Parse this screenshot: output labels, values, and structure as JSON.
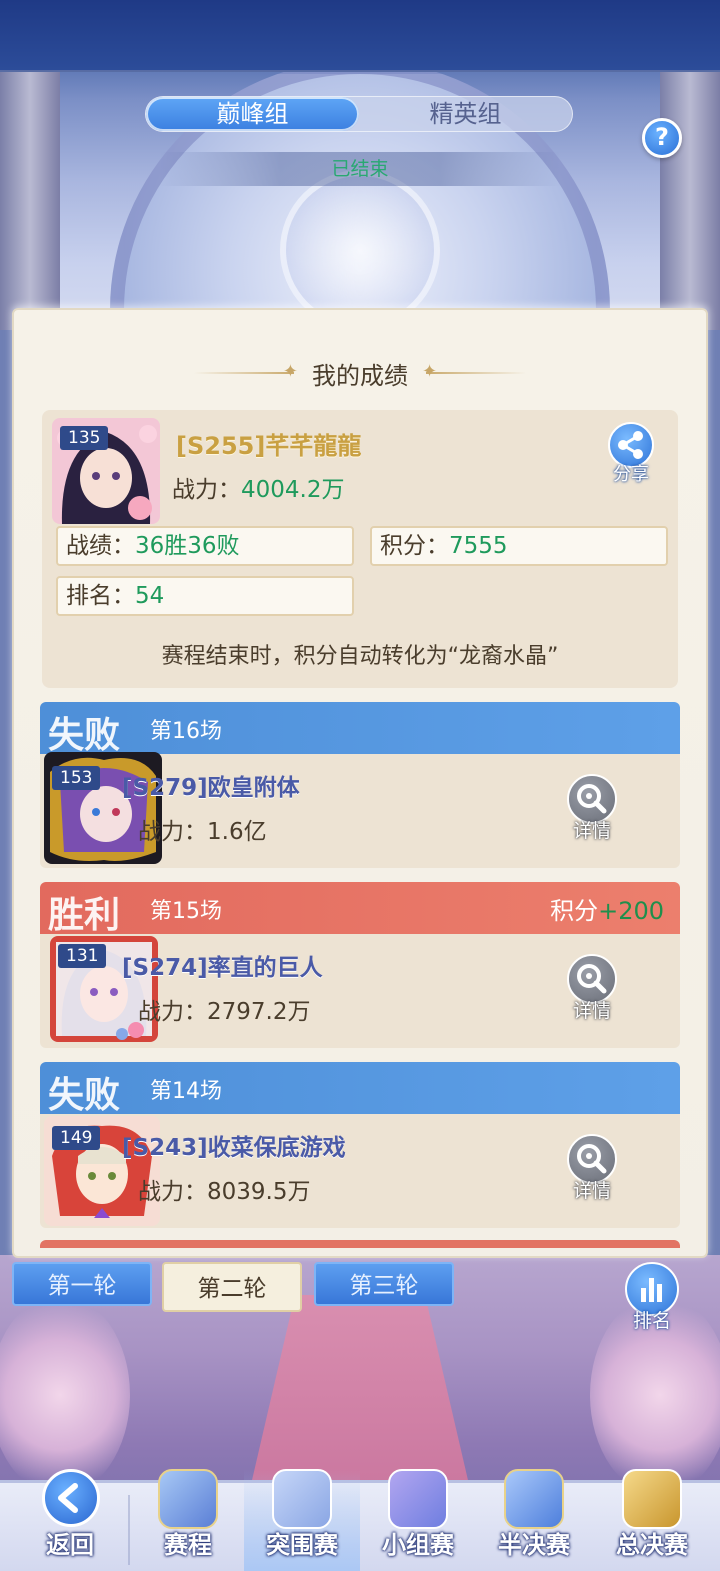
{
  "groups": {
    "peak": "巅峰组",
    "elite": "精英组",
    "active": "peak"
  },
  "status": "已结束",
  "help_label": "?",
  "panel_title": "我的成绩",
  "me": {
    "level": "135",
    "name": "[S255]芊芊龍龍",
    "power_label": "战力：",
    "power_value": "4004.2万",
    "share_label": "分享",
    "record_label": "战绩：",
    "record_value": "36胜36败",
    "score_label": "积分：",
    "score_value": "7555",
    "rank_label": "排名：",
    "rank_value": "54"
  },
  "convert_note": "赛程结束时，积分自动转化为“龙裔水晶”",
  "matches": [
    {
      "result": "失败",
      "round": "第16场",
      "level": "153",
      "opponent": "[S279]欧皇附体",
      "power_label": "战力：",
      "power": "1.6亿",
      "detail": "详情"
    },
    {
      "result": "胜利",
      "round": "第15场",
      "score_label": "积分",
      "score_delta": "+200",
      "level": "131",
      "opponent": "[S274]率直的巨人",
      "power_label": "战力：",
      "power": "2797.2万",
      "detail": "详情"
    },
    {
      "result": "失败",
      "round": "第14场",
      "level": "149",
      "opponent": "[S243]收菜保底游戏",
      "power_label": "战力：",
      "power": "8039.5万",
      "detail": "详情"
    }
  ],
  "round_tabs": [
    "第一轮",
    "第二轮",
    "第三轮"
  ],
  "active_round": "第二轮",
  "rank_label": "排名",
  "nav": [
    "返回",
    "赛程",
    "突围赛",
    "小组赛",
    "半决赛",
    "总决赛"
  ],
  "active_nav": "突围赛",
  "colors": {
    "win": "#e26a5e",
    "lose": "#4e8fd8",
    "value_green": "#1f9a5c",
    "accent_blue": "#3b7fe0"
  }
}
